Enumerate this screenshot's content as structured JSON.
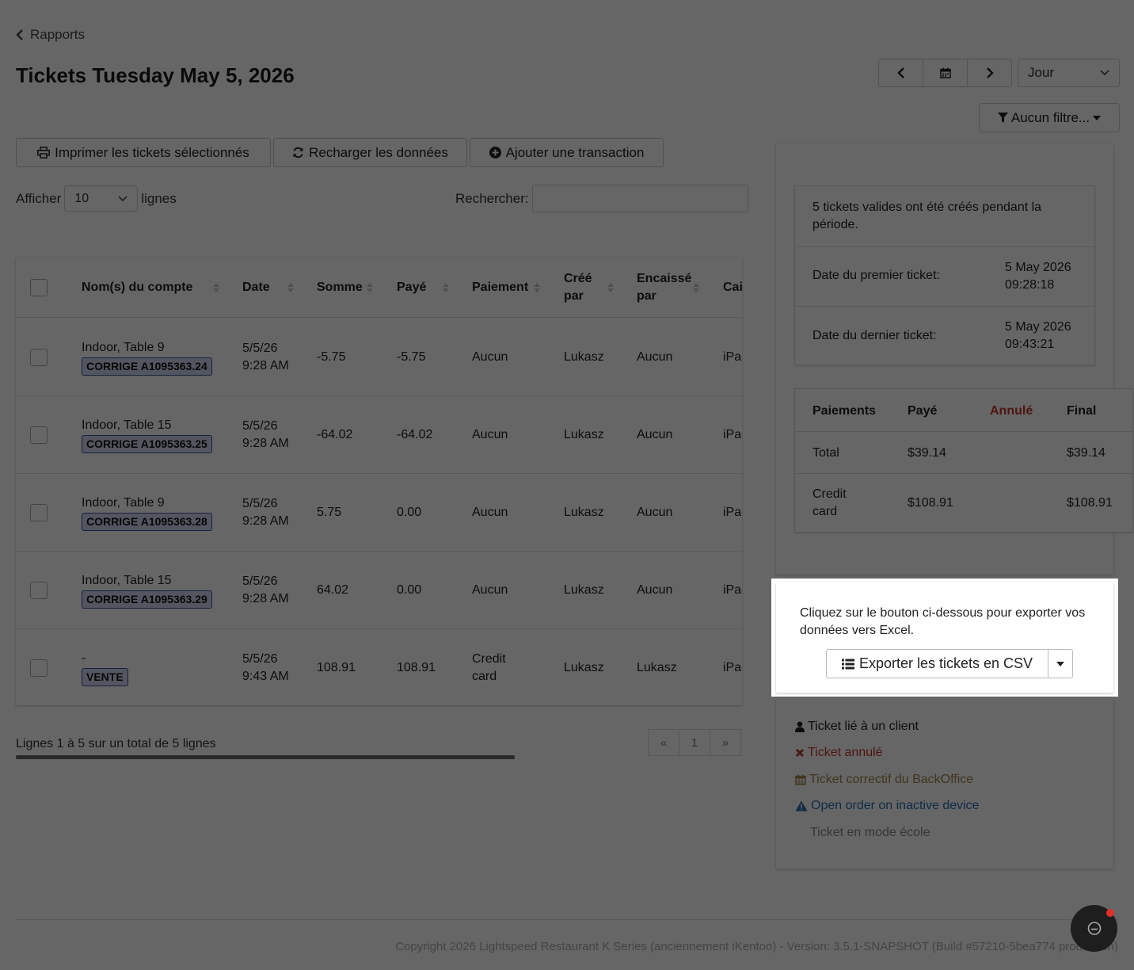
{
  "nav": {
    "back_label": "Rapports"
  },
  "page": {
    "title": "Tickets Tuesday May 5, 2026"
  },
  "period": {
    "selected": "Jour"
  },
  "filter": {
    "label": "Aucun filtre..."
  },
  "actions": {
    "print_label": "Imprimer les tickets sélectionnés",
    "reload_label": "Recharger les données",
    "add_label": "Ajouter une transaction"
  },
  "table_controls": {
    "show_label": "Afficher",
    "page_length": "10",
    "rows_label": "lignes",
    "search_label": "Rechercher:",
    "search_value": ""
  },
  "table": {
    "columns": [
      "Nom(s) du compte",
      "Date",
      "Somme",
      "Payé",
      "Paiement",
      "Créé par",
      "Encaissé par",
      "Cai"
    ],
    "rows": [
      {
        "account": "Indoor, Table 9",
        "badge": "CORRIGE A1095363.24",
        "date": "5/5/26 9:28 AM",
        "amount": "-5.75",
        "paid": "-5.75",
        "payment": "Aucun",
        "created_by": "Lukasz",
        "cashed_by": "Aucun",
        "register": "iPad"
      },
      {
        "account": "Indoor, Table 15",
        "badge": "CORRIGE A1095363.25",
        "date": "5/5/26 9:28 AM",
        "amount": "-64.02",
        "paid": "-64.02",
        "payment": "Aucun",
        "created_by": "Lukasz",
        "cashed_by": "Aucun",
        "register": "iPad"
      },
      {
        "account": "Indoor, Table 9",
        "badge": "CORRIGE A1095363.28",
        "date": "5/5/26 9:28 AM",
        "amount": "5.75",
        "paid": "0.00",
        "payment": "Aucun",
        "created_by": "Lukasz",
        "cashed_by": "Aucun",
        "register": "iPad"
      },
      {
        "account": "Indoor, Table 15",
        "badge": "CORRIGE A1095363.29",
        "date": "5/5/26 9:28 AM",
        "amount": "64.02",
        "paid": "0.00",
        "payment": "Aucun",
        "created_by": "Lukasz",
        "cashed_by": "Aucun",
        "register": "iPad"
      },
      {
        "account": "-",
        "badge": "VENTE",
        "date": "5/5/26 9:43 AM",
        "amount": "108.91",
        "paid": "108.91",
        "payment": "Credit card",
        "created_by": "Lukasz",
        "cashed_by": "Lukasz",
        "register": "iPad"
      }
    ],
    "info": "Lignes 1 à 5 sur un total de 5 lignes",
    "pagination": {
      "prev": "«",
      "current": "1",
      "next": "»"
    }
  },
  "summary": {
    "note": "5 tickets valides ont été créés pendant la période.",
    "first_label": "Date du premier ticket:",
    "first_value": "5 May 2026 09:28:18",
    "last_label": "Date du dernier ticket:",
    "last_value": "5 May 2026 09:43:21"
  },
  "payments": {
    "headers": {
      "method": "Paiements",
      "paid": "Payé",
      "voided": "Annulé",
      "final": "Final"
    },
    "rows": [
      {
        "method": "Total",
        "paid": "$39.14",
        "voided": "",
        "final": "$39.14"
      },
      {
        "method": "Credit card",
        "paid": "$108.91",
        "voided": "",
        "final": "$108.91"
      }
    ]
  },
  "export": {
    "text": "Cliquez sur le bouton ci-dessous pour exporter vos données vers Excel.",
    "button_label": "Exporter les tickets en CSV"
  },
  "legend": {
    "client": "Ticket lié à un client",
    "voided": "Ticket annulé",
    "backoffice": "Ticket correctif du BackOffice",
    "inactive": "Open order on inactive device",
    "school": "Ticket en mode école"
  },
  "footer": {
    "copyright": "Copyright 2026 Lightspeed Restaurant K Series (anciennement iKentoo) - Version: 3.5.1-SNAPSHOT (Build #57210-5bea774 production)"
  },
  "colors": {
    "voided": "#c0392b",
    "backoffice": "#a0864a",
    "inactive": "#2b6cb0",
    "school": "#888888",
    "badge_bg": "#cfd8ef",
    "overlay": "rgba(0,0,0,0.6)"
  }
}
